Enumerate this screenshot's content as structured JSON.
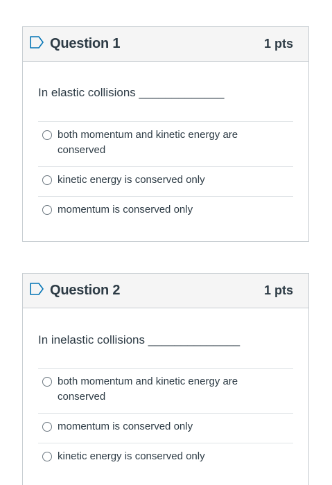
{
  "questions": [
    {
      "title": "Question 1",
      "points": "1 pts",
      "prompt": "In elastic collisions _____________",
      "flag_icon": "flag-outline-icon",
      "answers": [
        "both momentum and kinetic energy are conserved",
        "kinetic energy is conserved only",
        "momentum is conserved only"
      ]
    },
    {
      "title": "Question 2",
      "points": "1 pts",
      "prompt": "In inelastic collisions ______________",
      "flag_icon": "flag-outline-icon",
      "answers": [
        "both momentum and kinetic energy are conserved",
        "momentum is conserved only",
        "kinetic energy is conserved only"
      ]
    }
  ],
  "colors": {
    "header_bg": "#f5f5f5",
    "border": "#c7cdd1",
    "text": "#2d3b45",
    "flag": "#0374b5"
  }
}
